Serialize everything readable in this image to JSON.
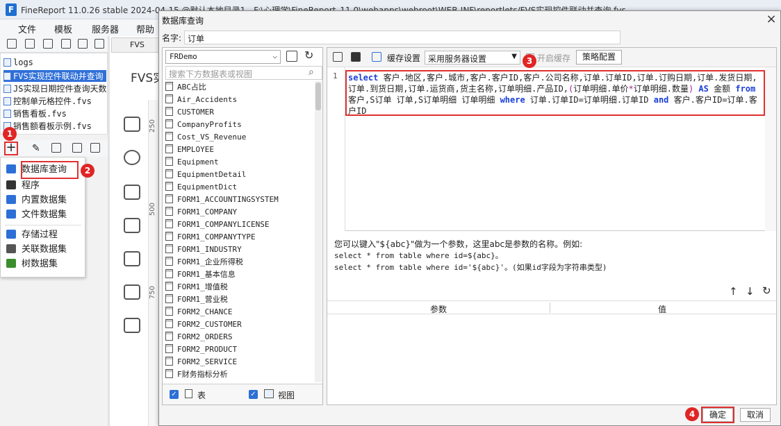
{
  "app": {
    "title": "FineReport 11.0.26 stable 2024-04-15 @默认本地目录1 - F:\\心理学\\FineReport_11.0\\webapps\\webroot\\WEB-INF\\reportlets/FVS实现控件联动并查询.fvs",
    "logo": "F"
  },
  "menu": [
    "文件",
    "模板",
    "服务器",
    "帮助"
  ],
  "file_tree": [
    "logs",
    "FVS实现控件联动并查询",
    "JS实现日期控件查询天数",
    "控制单元格控件.fvs",
    "销售看板.fvs",
    "销售额看板示例.fvs"
  ],
  "bg": {
    "tab": "FVS",
    "doc_title": "FVS实",
    "ruler": [
      "250",
      "500",
      "750"
    ]
  },
  "ds_menu": [
    "数据库查询",
    "程序",
    "内置数据集",
    "文件数据集",
    "存储过程",
    "关联数据集",
    "树数据集"
  ],
  "ds_colors": [
    "#2d6fd6",
    "#333333",
    "#2d6fd6",
    "#2d6fd6",
    "#2d6fd6",
    "#555555",
    "#3a8f2c"
  ],
  "callouts": [
    "1",
    "2",
    "3",
    "4"
  ],
  "dialog": {
    "title": "数据库查询",
    "name_label": "名字:",
    "name_value": "订单",
    "datasource": "FRDemo",
    "search_placeholder": "搜索下方数据表或视图",
    "tables": [
      "ABC占比",
      "Air_Accidents",
      "CUSTOMER",
      "CompanyProfits",
      "Cost_VS_Revenue",
      "EMPLOYEE",
      "Equipment",
      "EquipmentDetail",
      "EquipmentDict",
      "FORM1_ACCOUNTINGSYSTEM",
      "FORM1_COMPANY",
      "FORM1_COMPANYLICENSE",
      "FORM1_COMPANYTYPE",
      "FORM1_INDUSTRY",
      "FORM1_企业所得税",
      "FORM1_基本信息",
      "FORM1_增值税",
      "FORM1_营业税",
      "FORM2_CHANCE",
      "FORM2_CUSTOMER",
      "FORM2_ORDERS",
      "FORM2_PRODUCT",
      "FORM2_SERVICE",
      "F财务指标分析"
    ],
    "table_check_label": "表",
    "view_check_label": "视图",
    "cache_label": "缓存设置",
    "cache_value": "采用服务器设置",
    "open_cache_label": "开启缓存",
    "strategy_label": "策略配置",
    "line_number": "1",
    "sql": [
      {
        "t": "select",
        "c": "kw"
      },
      {
        "t": " 客户.地区,客户.城市,客户.客户ID,客户.公司名称,订单.订单ID,订单.订购日期,订单.发货日期,订单.到货日期,订单.运货商,货主名称,订单明细.产品ID,",
        "c": ""
      },
      {
        "t": "(",
        "c": "pu"
      },
      {
        "t": "订单明细.单价",
        "c": ""
      },
      {
        "t": "*",
        "c": "pu"
      },
      {
        "t": "订单明细.数量",
        "c": ""
      },
      {
        "t": ")",
        "c": "pu"
      },
      {
        "t": " AS ",
        "c": "kw"
      },
      {
        "t": "金额 ",
        "c": ""
      },
      {
        "t": "from",
        "c": "kw"
      },
      {
        "t": " 客户,S订单 订单,S订单明细 订单明细 ",
        "c": ""
      },
      {
        "t": "where",
        "c": "kw"
      },
      {
        "t": " 订单.订单ID=订单明细.订单ID ",
        "c": ""
      },
      {
        "t": "and",
        "c": "kw"
      },
      {
        "t": " 客户.客户ID=订单.客户ID",
        "c": ""
      }
    ],
    "hint_line1": "您可以键入\"${abc}\"做为一个参数，这里abc是参数的名称。例如:",
    "hint_line2": "select * from table where id=${abc}。",
    "hint_line3": "select * from table where id='${abc}'。(如果id字段为字符串类型)",
    "param_col": "参数",
    "value_col": "值",
    "ok_label": "确定",
    "cancel_label": "取消"
  }
}
